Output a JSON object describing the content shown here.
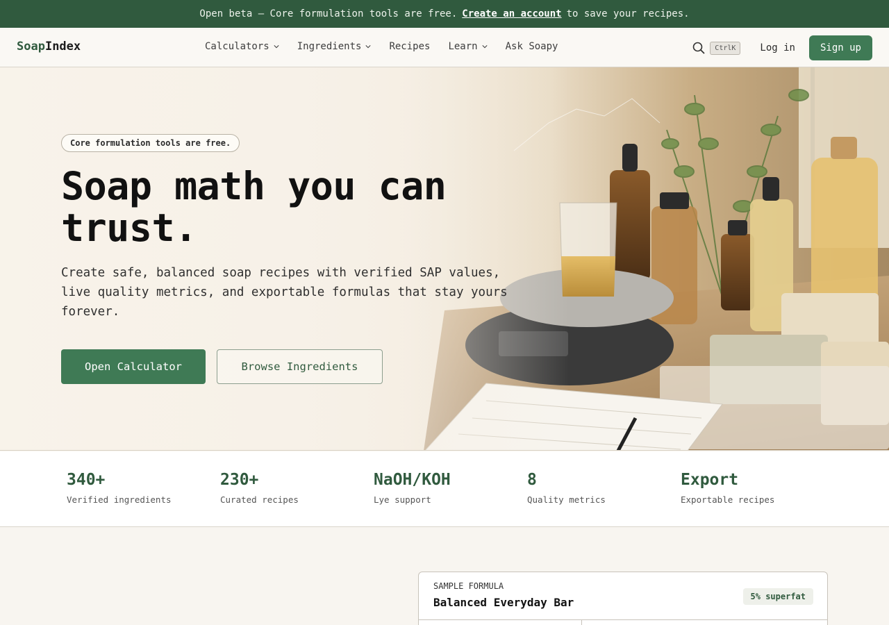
{
  "banner": {
    "text_before": "Open beta — Core formulation tools are free.",
    "link": "Create an account",
    "text_after": "to save your recipes."
  },
  "nav": {
    "logo_part1": "Soap",
    "logo_part2": "Index",
    "items": [
      {
        "label": "Calculators",
        "dropdown": true
      },
      {
        "label": "Ingredients",
        "dropdown": true
      },
      {
        "label": "Recipes",
        "dropdown": false
      },
      {
        "label": "Learn",
        "dropdown": true
      },
      {
        "label": "Ask Soapy",
        "dropdown": false
      }
    ],
    "search_shortcut": "CtrlK",
    "login_label": "Log in",
    "signup_label": "Sign up"
  },
  "hero": {
    "badge": "Core formulation tools are free.",
    "headline": "Soap math you can trust.",
    "lede": "Create safe, balanced soap recipes with verified SAP values, live quality metrics, and exportable formulas that stay yours forever.",
    "primary_cta": "Open Calculator",
    "secondary_cta": "Browse Ingredients"
  },
  "stats": [
    {
      "value": "340+",
      "label": "Verified ingredients"
    },
    {
      "value": "230+",
      "label": "Curated recipes"
    },
    {
      "value": "NaOH/KOH",
      "label": "Lye support"
    },
    {
      "value": "8",
      "label": "Quality metrics"
    },
    {
      "value": "Export",
      "label": "Exportable recipes"
    }
  ],
  "sample": {
    "kicker": "SAMPLE FORMULA",
    "title": "Balanced Everyday Bar",
    "badge": "5% superfat"
  },
  "colors": {
    "brand": "#305a3e",
    "button": "#3f7a55",
    "background": "#f8f5f0"
  }
}
